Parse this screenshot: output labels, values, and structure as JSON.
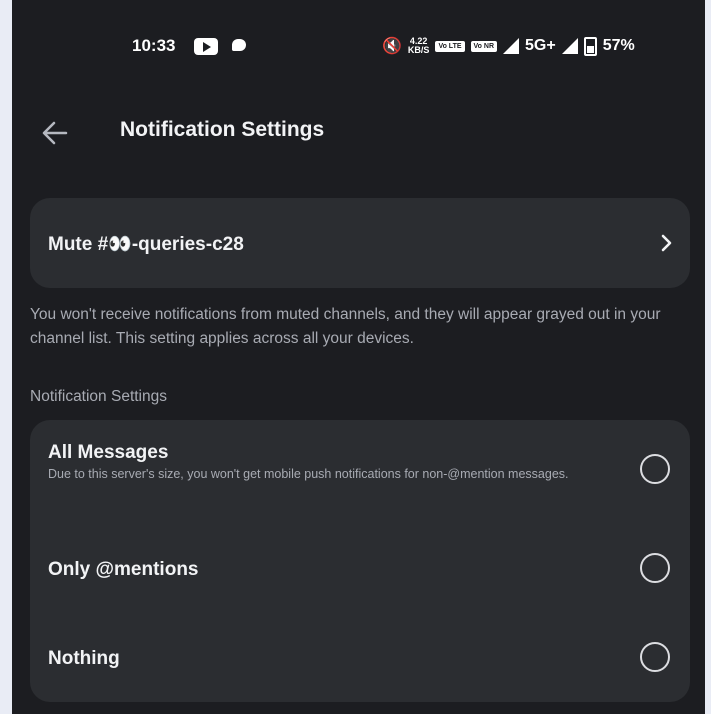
{
  "status_bar": {
    "time": "10:33",
    "speed_value": "4.22",
    "speed_unit": "KB/S",
    "sim1_tag": "Vo LTE",
    "sim2_tag": "Vo NR",
    "network": "5G+",
    "battery": "57%"
  },
  "header": {
    "title": "Notification Settings"
  },
  "mute": {
    "label": "Mute #👀-queries-c28",
    "description": "You won't receive notifications from muted channels, and they will appear grayed out in your channel list. This setting applies across all your devices."
  },
  "notification_section": {
    "label": "Notification Settings",
    "options": [
      {
        "title": "All Messages",
        "subtitle": "Due to this server's size, you won't get mobile push notifications for non-@mention messages.",
        "selected": false
      },
      {
        "title": "Only @mentions",
        "selected": false
      },
      {
        "title": "Nothing",
        "selected": false
      }
    ]
  },
  "colors": {
    "background": "#1c1d21",
    "card": "#2b2d31",
    "text_primary": "#f2f3f5",
    "text_muted": "#a8abb3"
  }
}
